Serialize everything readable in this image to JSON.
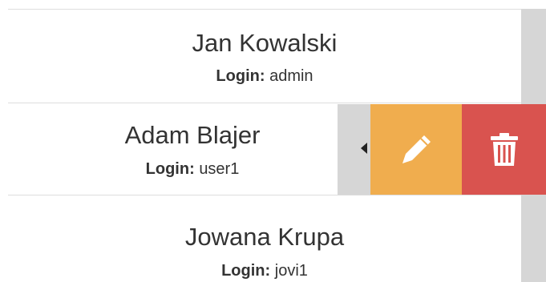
{
  "users": [
    {
      "name": "Jan Kowalski",
      "login_label": "Login:",
      "login": "admin"
    },
    {
      "name": "Adam Blajer",
      "login_label": "Login:",
      "login": "user1"
    },
    {
      "name": "Jowana Krupa",
      "login_label": "Login:",
      "login": "jovi1"
    }
  ],
  "icons": {
    "edit": "pencil-icon",
    "delete": "trash-icon",
    "handle": "chevron-left-icon"
  },
  "colors": {
    "edit": "#f0ad4e",
    "delete": "#d9534f",
    "handle": "#d6d6d6",
    "text": "#333333"
  }
}
